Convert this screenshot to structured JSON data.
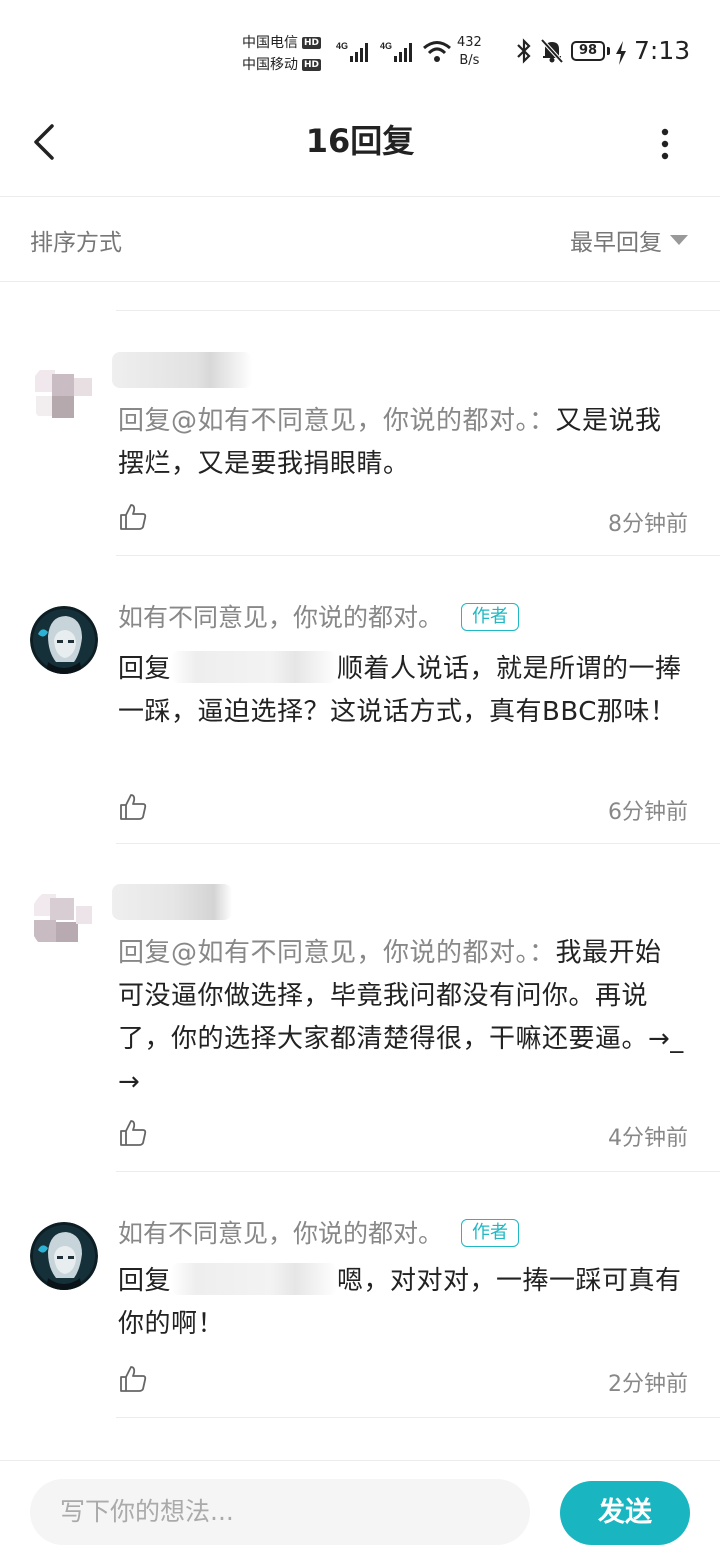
{
  "status_bar": {
    "carrier_1": "中国电信",
    "carrier_2": "中国移动",
    "hd_badge": "HD",
    "network_1": "4G",
    "network_2": "4G",
    "speed_value": "432",
    "speed_unit": "B/s",
    "battery": "98",
    "time": "7:13"
  },
  "header": {
    "title": "16回复",
    "back_icon": "chevron-left-icon",
    "more_icon": "more-vertical-icon"
  },
  "sort": {
    "label": "排序方式",
    "selected": "最早回复"
  },
  "comments": [
    {
      "is_author": false,
      "prefix": "回复@如有不同意见，你说的都对。：",
      "text": "又是说我摆烂，又是要我捐眼睛。",
      "time": "8分钟前"
    },
    {
      "is_author": true,
      "name": "如有不同意见，你说的都对。",
      "badge": "作者",
      "prefix": "回复",
      "text": "顺着人说话，就是所谓的一捧一踩，逼迫选择？这说话方式，真有BBC那味！",
      "time": "6分钟前"
    },
    {
      "is_author": false,
      "prefix": "回复@如有不同意见，你说的都对。：",
      "text": "我最开始可没逼你做选择，毕竟我问都没有问你。再说了，你的选择大家都清楚得很，干嘛还要逼。→_→",
      "time": "4分钟前"
    },
    {
      "is_author": true,
      "name": "如有不同意见，你说的都对。",
      "badge": "作者",
      "prefix": "回复",
      "text": "嗯，对对对，一捧一踩可真有你的啊！",
      "time": "2分钟前"
    }
  ],
  "composer": {
    "placeholder": "写下你的想法...",
    "send_label": "发送"
  },
  "colors": {
    "accent": "#19b5c1",
    "badge": "#1fb8c5",
    "muted_text": "#888888"
  }
}
